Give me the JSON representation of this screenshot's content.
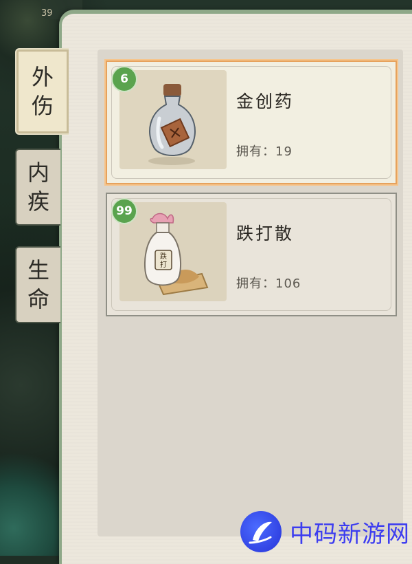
{
  "background": {
    "corner_number": "39"
  },
  "tabs": [
    {
      "id": "external",
      "char1": "外",
      "char2": "伤",
      "active": true
    },
    {
      "id": "internal",
      "char1": "内",
      "char2": "疾",
      "active": false
    },
    {
      "id": "life",
      "char1": "生",
      "char2": "命",
      "active": false
    }
  ],
  "items": [
    {
      "badge": "6",
      "name": "金创药",
      "owned_label": "拥有：",
      "owned_count": "19",
      "icon": "medicine-bottle-icon",
      "selected": true
    },
    {
      "badge": "99",
      "name": "跌打散",
      "owned_label": "拥有：",
      "owned_count": "106",
      "icon": "medicine-powder-icon",
      "selected": false
    }
  ],
  "watermark": {
    "text": "中码新游网"
  },
  "colors": {
    "selected_border": "#e6a25d",
    "badge": "#5aa34e",
    "paper": "#ece7dc",
    "watermark": "#3c3cf0"
  }
}
